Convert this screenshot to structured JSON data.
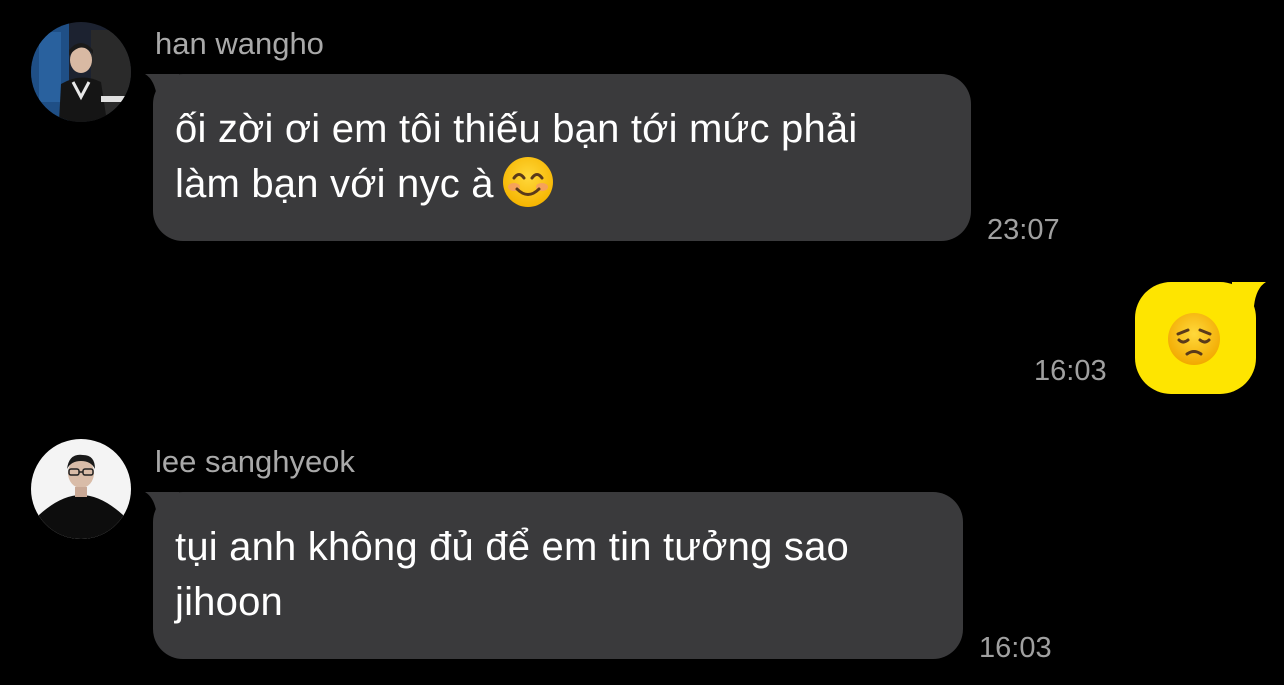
{
  "messages": [
    {
      "sender": "han wangho",
      "avatar_icon": "profile-photo-dark-icon",
      "lines": [
        "ối zời ơi em tôi thiếu bạn tới mức phải",
        "làm bạn với nyc à"
      ],
      "emoji": "smiling-face-icon",
      "time": "23:07"
    },
    {
      "outgoing": true,
      "emoji": "pensive-face-icon",
      "bubble_color": "#fee500",
      "time": "16:03"
    },
    {
      "sender": "lee sanghyeok",
      "avatar_icon": "profile-photo-light-icon",
      "lines": [
        "tụi anh không đủ để em tin tưởng sao",
        "jihoon"
      ],
      "time": "16:03"
    }
  ],
  "colors": {
    "background": "#000000",
    "incoming_bubble": "#3a3a3c",
    "outgoing_bubble": "#fee500",
    "name_text": "#a9a9a9",
    "time_text": "#a0a0a0"
  }
}
